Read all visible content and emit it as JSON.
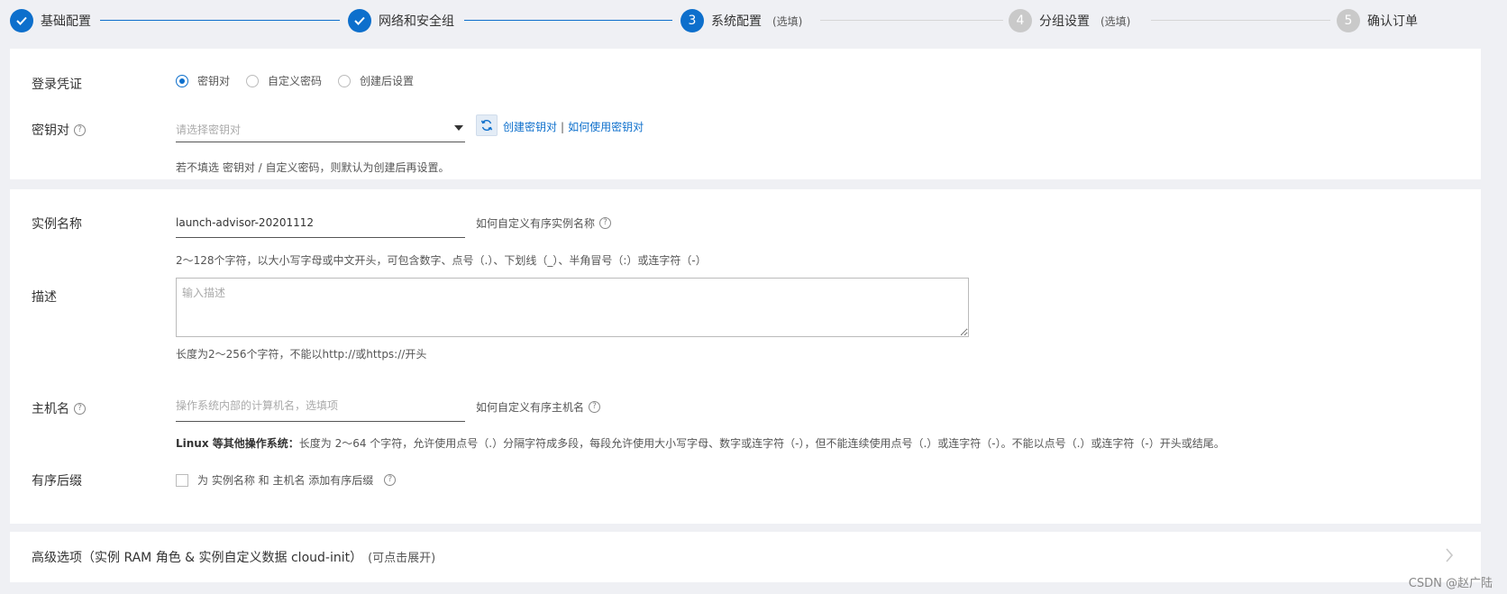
{
  "steps": [
    {
      "num": "✓",
      "label": "基础配置",
      "optional": "",
      "state": "done"
    },
    {
      "num": "✓",
      "label": "网络和安全组",
      "optional": "",
      "state": "done"
    },
    {
      "num": "3",
      "label": "系统配置",
      "optional": "(选填)",
      "state": "active"
    },
    {
      "num": "4",
      "label": "分组设置",
      "optional": "(选填)",
      "state": "pending"
    },
    {
      "num": "5",
      "label": "确认订单",
      "optional": "",
      "state": "pending"
    }
  ],
  "credentials": {
    "label": "登录凭证",
    "options": [
      "密钥对",
      "自定义密码",
      "创建后设置"
    ],
    "selected": "密钥对"
  },
  "keypair": {
    "label": "密钥对",
    "placeholder": "请选择密钥对",
    "create_link": "创建密钥对",
    "separator": "|",
    "usage_link": "如何使用密钥对",
    "hint": "若不填选 密钥对 / 自定义密码，则默认为创建后再设置。"
  },
  "instance_name": {
    "label": "实例名称",
    "value": "launch-advisor-20201112",
    "help": "如何自定义有序实例名称",
    "hint": "2～128个字符，以大小写字母或中文开头，可包含数字、点号（.）、下划线（_）、半角冒号（:）或连字符（-）"
  },
  "description": {
    "label": "描述",
    "placeholder": "输入描述",
    "hint": "长度为2～256个字符，不能以http://或https://开头"
  },
  "hostname": {
    "label": "主机名",
    "placeholder": "操作系统内部的计算机名，选填项",
    "help": "如何自定义有序主机名",
    "hint_bold": "Linux 等其他操作系统：",
    "hint": "长度为 2～64 个字符，允许使用点号（.）分隔字符成多段，每段允许使用大小写字母、数字或连字符（-），但不能连续使用点号（.）或连字符（-）。不能以点号（.）或连字符（-）开头或结尾。"
  },
  "suffix": {
    "label": "有序后缀",
    "checkbox_label": "为 实例名称 和 主机名 添加有序后缀",
    "checked": false
  },
  "advanced": {
    "title": "高级选项（实例 RAM 角色 & 实例自定义数据 cloud-init）",
    "hint": "(可点击展开)"
  },
  "watermark": "CSDN @赵广陆",
  "colors": {
    "primary": "#0d6fcc",
    "pending": "#c9c9c9",
    "background": "#eff0f4"
  }
}
